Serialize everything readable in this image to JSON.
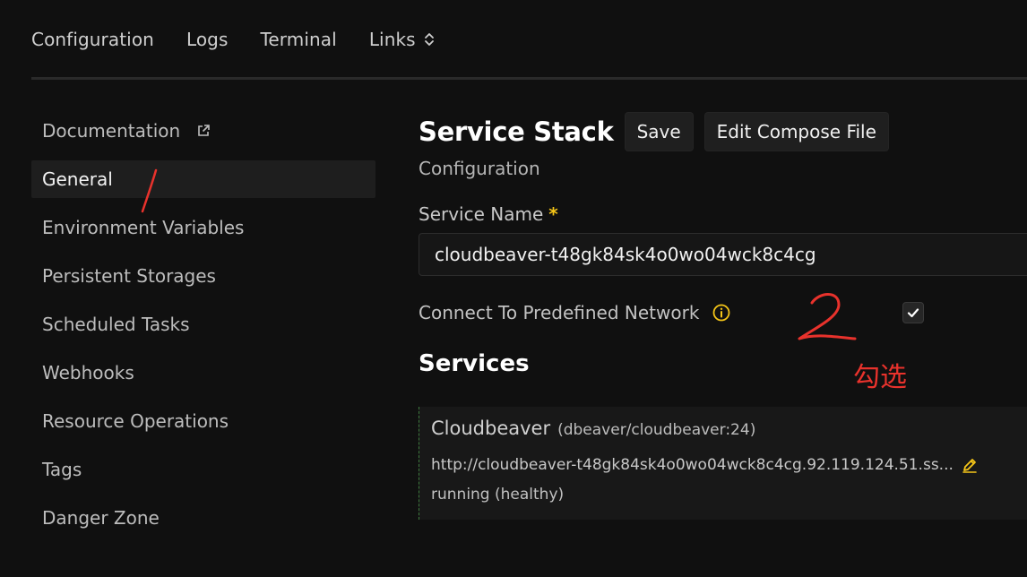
{
  "topnav": {
    "items": [
      {
        "label": "Configuration"
      },
      {
        "label": "Logs"
      },
      {
        "label": "Terminal"
      },
      {
        "label": "Links"
      }
    ]
  },
  "sidebar": {
    "items": [
      {
        "label": "Documentation"
      },
      {
        "label": "General"
      },
      {
        "label": "Environment Variables"
      },
      {
        "label": "Persistent Storages"
      },
      {
        "label": "Scheduled Tasks"
      },
      {
        "label": "Webhooks"
      },
      {
        "label": "Resource Operations"
      },
      {
        "label": "Tags"
      },
      {
        "label": "Danger Zone"
      }
    ]
  },
  "main": {
    "title": "Service Stack",
    "save_label": "Save",
    "edit_compose_label": "Edit Compose File",
    "subtitle": "Configuration",
    "service_name_label": "Service Name",
    "required_mark": "*",
    "service_name_value": "cloudbeaver-t48gk84sk4o0wo04wck8c4cg",
    "network_label": "Connect To Predefined Network",
    "network_checked": true,
    "services_title": "Services",
    "service": {
      "name": "Cloudbeaver",
      "image": "(dbeaver/cloudbeaver:24)",
      "url": "http://cloudbeaver-t48gk84sk4o0wo04wck8c4cg.92.119.124.51.ss...",
      "status": "running (healthy)"
    }
  },
  "annotations": {
    "number": "2",
    "text": "勾选"
  },
  "colors": {
    "background": "#101010",
    "accent_yellow": "#f5c518",
    "annotation_red": "#e8322c"
  }
}
